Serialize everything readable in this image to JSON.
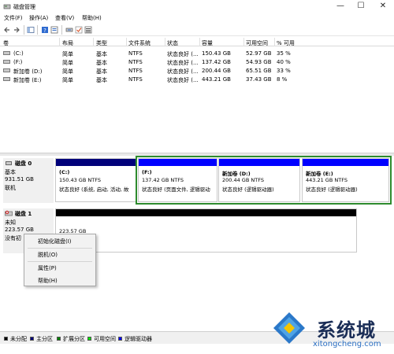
{
  "window": {
    "title": "磁盘管理",
    "minimize": "—",
    "maximize": "☐",
    "close": "✕"
  },
  "menu": [
    "文件(F)",
    "操作(A)",
    "查看(V)",
    "帮助(H)"
  ],
  "table": {
    "columns": [
      "卷",
      "布局",
      "类型",
      "文件系统",
      "状态",
      "容量",
      "可用空间",
      "% 可用"
    ],
    "rows": [
      [
        "(C:)",
        "简单",
        "基本",
        "NTFS",
        "状态良好 (...",
        "150.43 GB",
        "52.97 GB",
        "35 %"
      ],
      [
        "(F:)",
        "简单",
        "基本",
        "NTFS",
        "状态良好 (...",
        "137.42 GB",
        "54.93 GB",
        "40 %"
      ],
      [
        "新加卷 (D:)",
        "简单",
        "基本",
        "NTFS",
        "状态良好 (...",
        "200.44 GB",
        "65.51 GB",
        "33 %"
      ],
      [
        "新加卷 (E:)",
        "简单",
        "基本",
        "NTFS",
        "状态良好 (...",
        "443.21 GB",
        "37.43 GB",
        "8 %"
      ]
    ]
  },
  "disks": [
    {
      "name": "磁盘 0",
      "type": "基本",
      "size": "931.51 GB",
      "status": "联机",
      "partitions": [
        {
          "name": "(C:)",
          "size": "150.43 GB NTFS",
          "status": "状态良好 (系统, 启动, 活动, 故"
        },
        {
          "name": "(F:)",
          "size": "137.42 GB NTFS",
          "status": "状态良好 (页面文件, 逻辑驱动"
        },
        {
          "name": "新加卷 (D:)",
          "size": "200.44 GB NTFS",
          "status": "状态良好 (逻辑驱动器)"
        },
        {
          "name": "新加卷 (E:)",
          "size": "443.21 GB NTFS",
          "status": "状态良好 (逻辑驱动器)"
        }
      ]
    },
    {
      "name": "磁盘 1",
      "type": "未知",
      "size": "223.57 GB",
      "status": "没有初",
      "partitions": [
        {
          "size": "223.57 GB"
        }
      ]
    }
  ],
  "context_menu": [
    "初始化磁盘(I)",
    "脱机(O)",
    "属性(P)",
    "帮助(H)"
  ],
  "legend": [
    {
      "label": "未分配",
      "color": "#000000"
    },
    {
      "label": "主分区",
      "color": "#00007a"
    },
    {
      "label": "扩展分区",
      "color": "#008000"
    },
    {
      "label": "可用空间",
      "color": "#00e000"
    },
    {
      "label": "逻辑驱动器",
      "color": "#0000ff"
    }
  ],
  "watermark": {
    "text": "系统城",
    "url": "xitongcheng.com"
  },
  "colors": {
    "primary_bar": "#00007a",
    "logical_bar": "#0000ff",
    "unallocated_bar": "#000000",
    "selection": "#2e8b2e"
  }
}
